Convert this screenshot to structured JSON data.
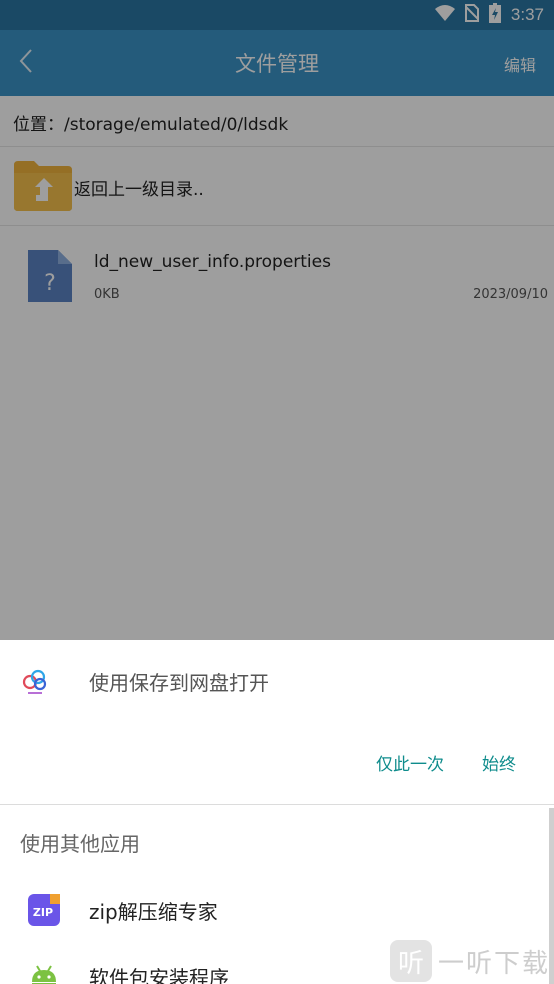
{
  "status_bar": {
    "time": "3:37",
    "icons": [
      "wifi-icon",
      "no-sim-icon",
      "battery-charging-icon"
    ]
  },
  "app_bar": {
    "title": "文件管理",
    "edit_label": "编辑",
    "back_icon": "chevron-left-icon"
  },
  "browser": {
    "path_label": "位置：/storage/emulated/0/ldsdk",
    "up_label": "返回上一级目录..",
    "files": [
      {
        "name": "ld_new_user_info.properties",
        "size": "0KB",
        "date": "2023/09/10",
        "icon": "unknown-file-icon"
      }
    ]
  },
  "chooser": {
    "default_app_label": "使用保存到网盘打开",
    "just_once_label": "仅此一次",
    "always_label": "始终",
    "other_apps_header": "使用其他应用",
    "apps": [
      {
        "name": "zip解压缩专家",
        "icon": "zip-icon"
      },
      {
        "name": "软件包安装程序",
        "icon": "android-icon"
      }
    ]
  },
  "watermark": {
    "icon_glyph": "听",
    "text": "一听下载"
  },
  "colors": {
    "status_bar": "#2a77a3",
    "app_bar": "#3b94c7",
    "action_teal": "#0f8c8c",
    "folder": "#f0b43c",
    "file_icon": "#5b84c4"
  }
}
